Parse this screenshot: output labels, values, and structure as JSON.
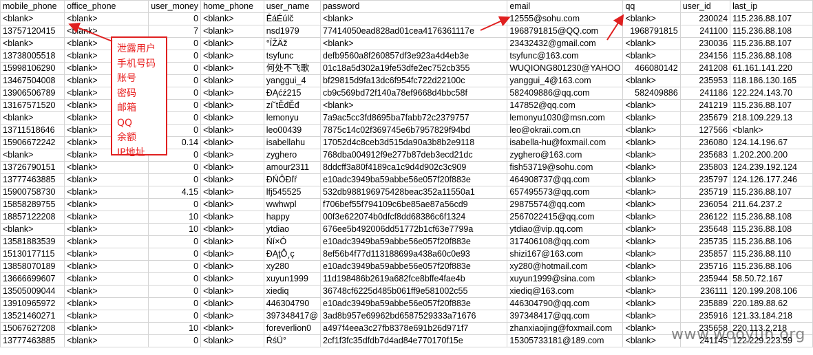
{
  "columns": [
    "mobile_phone",
    "office_phone",
    "user_money",
    "home_phone",
    "user_name",
    "password",
    "email",
    "qq",
    "user_id",
    "last_ip"
  ],
  "rows": [
    [
      "<blank>",
      "<blank>",
      "0",
      "<blank>",
      "ÊáÉúlč",
      "<blank>",
      "12555@sohu.com",
      "<blank>",
      "230024",
      "115.236.88.107"
    ],
    [
      "13757120415",
      "<blank>",
      "7",
      "<blank>",
      "nsd1979",
      "77414050ead828ad01cea4176361117e",
      "1968791815@QQ.com",
      "1968791815",
      "241100",
      "115.236.88.108"
    ],
    [
      "<blank>",
      "<blank>",
      "0",
      "<blank>",
      "°ÏŽÄž",
      "<blank>",
      "23432432@gmail.com",
      "<blank>",
      "230036",
      "115.236.88.107"
    ],
    [
      "13738005518",
      "<blank>",
      "0",
      "<blank>",
      "tsyfunc",
      "defb9560a8f260857df3e923a4d4eb3e",
      "tsyfunc@163.com",
      "<blank>",
      "234156",
      "115.236.88.108"
    ],
    [
      "15998106290",
      "<blank>",
      "0",
      "<blank>",
      "何处不飞歌",
      "01c18a5d302a19fe53dfe2ec752cb355",
      "WUQIONG801230@YAHOO",
      "466080142",
      "241208",
      "61.161.141.220"
    ],
    [
      "13467504008",
      "<blank>",
      "0",
      "<blank>",
      "yanggui_4",
      "bf29815d9fa13dc6f954fc722d22100c",
      "yanggui_4@163.com",
      "<blank>",
      "235953",
      "118.186.130.165"
    ],
    [
      "13906506789",
      "<blank>",
      "0",
      "<blank>",
      "ĐĄćź215",
      "cb9c569bd72f140a78ef9668d4bbc58f",
      "582409886@qq.com",
      "582409886",
      "241186",
      "122.224.143.70"
    ],
    [
      "13167571520",
      "<blank>",
      "0",
      "<blank>",
      "zí˘tĔđĔđ",
      "<blank>",
      "147852@qq.com",
      "<blank>",
      "241219",
      "115.236.88.107"
    ],
    [
      "<blank>",
      "<blank>",
      "0",
      "<blank>",
      "lemonyu",
      "7a9ac5cc3fd8695ba7fabb72c2379757",
      "lemonyu1030@msn.com",
      "<blank>",
      "235679",
      "218.109.229.13"
    ],
    [
      "13711518646",
      "<blank>",
      "0",
      "<blank>",
      "leo00439",
      "7875c14c02f369745e6b7957829f94bd",
      "leo@okraii.com.cn",
      "<blank>",
      "127566",
      "<blank>"
    ],
    [
      "15906672242",
      "<blank>",
      "0.14",
      "<blank>",
      "isabellahu",
      "17052d4c8ceb3d515da90a3b8b2e9118",
      "isabella-hu@foxmail.com",
      "<blank>",
      "236080",
      "124.14.196.67"
    ],
    [
      "<blank>",
      "<blank>",
      "0",
      "<blank>",
      "zyghero",
      "768dba004912f9e277b87deb3ecd21dc",
      "zyghero@163.com",
      "<blank>",
      "235683",
      "1.202.200.200"
    ],
    [
      "13726790151",
      "<blank>",
      "0",
      "<blank>",
      "amour2311",
      "8ddcff3a80f4189ca1c9d4d902c3c909",
      "fish53719@sohu.com",
      "<blank>",
      "235803",
      "124.239.192.124"
    ],
    [
      "13777463885",
      "<blank>",
      "0",
      "<blank>",
      "ĐŃÔĐľŕ",
      "e10adc3949ba59abbe56e057f20f883e",
      "464908737@qq.com",
      "<blank>",
      "235797",
      "124.126.177.246"
    ],
    [
      "15900758730",
      "<blank>",
      "4.15",
      "<blank>",
      "lfj545525",
      "532db988196975428beac352a11550a1",
      "657495573@qq.com",
      "<blank>",
      "235719",
      "115.236.88.107"
    ],
    [
      "15858289755",
      "<blank>",
      "0",
      "<blank>",
      "wwhwpl",
      "f706bef55f794109c6be85ae87a56cd9",
      "29875574@qq.com",
      "<blank>",
      "236054",
      "211.64.237.2"
    ],
    [
      "18857122208",
      "<blank>",
      "10",
      "<blank>",
      "happy",
      "00f3e622074b0dfcf8dd68386c6f1324",
      "2567022415@qq.com",
      "<blank>",
      "236122",
      "115.236.88.108"
    ],
    [
      "<blank>",
      "<blank>",
      "10",
      "<blank>",
      "ytdiao",
      "676ee5b492006dd51772b1cf63e7799a",
      "ytdiao@vip.qq.com",
      "<blank>",
      "235648",
      "115.236.88.108"
    ],
    [
      "13581883539",
      "<blank>",
      "0",
      "<blank>",
      "Ńí×Ó",
      "e10adc3949ba59abbe56e057f20f883e",
      "317406108@qq.com",
      "<blank>",
      "235735",
      "115.236.88.106"
    ],
    [
      "15130177115",
      "<blank>",
      "0",
      "<blank>",
      "ĐĄţÔ¸ç",
      "8ef56b4f77d113188699a438a60c0e93",
      "shizi167@163.com",
      "<blank>",
      "235857",
      "115.236.88.110"
    ],
    [
      "13858070189",
      "<blank>",
      "0",
      "<blank>",
      "xy280",
      "e10adc3949ba59abbe56e057f20f883e",
      "xy280@hotmail.com",
      "<blank>",
      "235716",
      "115.236.88.106"
    ],
    [
      "13666699607",
      "<blank>",
      "0",
      "<blank>",
      "xuyun1999",
      "11d198486b2619a682fce8bffe4fae4b",
      "xuyun1999@sina.com",
      "<blank>",
      "235944",
      "58.50.72.167"
    ],
    [
      "13505009044",
      "<blank>",
      "0",
      "<blank>",
      "xiediq",
      "36748cf6225d485b061ff9e581002c55",
      "xiediq@163.com",
      "<blank>",
      "236111",
      "120.199.208.106"
    ],
    [
      "13910965972",
      "<blank>",
      "0",
      "<blank>",
      "446304790",
      "e10adc3949ba59abbe56e057f20f883e",
      "446304790@qq.com",
      "<blank>",
      "235889",
      "220.189.88.62"
    ],
    [
      "13521460271",
      "<blank>",
      "0",
      "<blank>",
      "397348417@",
      "3ad8b957e69962bd6587529333a71676",
      "397348417@qq.com",
      "<blank>",
      "235916",
      "121.33.184.218"
    ],
    [
      "15067627208",
      "<blank>",
      "10",
      "<blank>",
      "foreverlion0",
      "a497f4eea3c27fb8378e691b26d971f7",
      "zhanxiaojing@foxmail.com",
      "<blank>",
      "235658",
      "220.113.2.218"
    ],
    [
      "13777463885",
      "<blank>",
      "0",
      "<blank>",
      "ŔśÜ°",
      "2cf1f3fc35dfdb7d4ad84e770170f15e",
      "15305733181@189.com",
      "<blank>",
      "241145",
      "122.229.223.59"
    ]
  ],
  "annotation": {
    "lines": [
      "泄露用户",
      "手机号码",
      "账号",
      "密码",
      "邮箱",
      "QQ",
      "余额",
      "IP地址"
    ],
    "color": "#e82020"
  },
  "watermark": "www.wooyun.org"
}
